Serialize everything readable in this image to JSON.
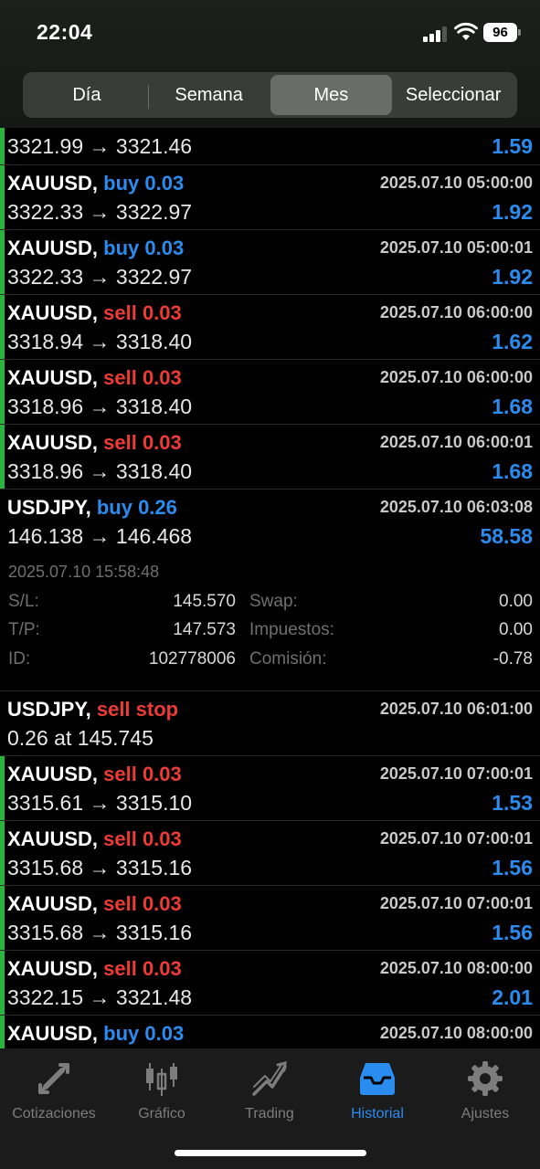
{
  "status": {
    "time": "22:04",
    "battery": "96"
  },
  "segments": [
    "Día",
    "Semana",
    "Mes",
    "Seleccionar"
  ],
  "active_segment": "Mes",
  "first_row": {
    "prices": "3321.99 → 3321.46",
    "profit": "1.59"
  },
  "rows": [
    {
      "symbol": "XAUUSD,",
      "side": "buy 0.03",
      "type": "buy",
      "time": "2025.07.10 05:00:00",
      "prices": "3322.33 → 3322.97",
      "profit": "1.92"
    },
    {
      "symbol": "XAUUSD,",
      "side": "buy 0.03",
      "type": "buy",
      "time": "2025.07.10 05:00:01",
      "prices": "3322.33 → 3322.97",
      "profit": "1.92"
    },
    {
      "symbol": "XAUUSD,",
      "side": "sell 0.03",
      "type": "sell",
      "time": "2025.07.10 06:00:00",
      "prices": "3318.94 → 3318.40",
      "profit": "1.62"
    },
    {
      "symbol": "XAUUSD,",
      "side": "sell 0.03",
      "type": "sell",
      "time": "2025.07.10 06:00:00",
      "prices": "3318.96 → 3318.40",
      "profit": "1.68"
    },
    {
      "symbol": "XAUUSD,",
      "side": "sell 0.03",
      "type": "sell",
      "time": "2025.07.10 06:00:01",
      "prices": "3318.96 → 3318.40",
      "profit": "1.68"
    }
  ],
  "expanded": {
    "symbol": "USDJPY,",
    "side": "buy 0.26",
    "time": "2025.07.10 06:03:08",
    "prices": "146.138 → 146.468",
    "profit": "58.58",
    "close_time": "2025.07.10 15:58:48",
    "sl_label": "S/L:",
    "sl_value": "145.570",
    "tp_label": "T/P:",
    "tp_value": "147.573",
    "id_label": "ID:",
    "id_value": "102778006",
    "swap_label": "Swap:",
    "swap_value": "0.00",
    "tax_label": "Impuestos:",
    "tax_value": "0.00",
    "commission_label": "Comisión:",
    "commission_value": "-0.78"
  },
  "pending": {
    "symbol": "USDJPY,",
    "side": "sell stop",
    "time": "2025.07.10 06:01:00",
    "prices": "0.26 at 145.745"
  },
  "rows2": [
    {
      "symbol": "XAUUSD,",
      "side": "sell 0.03",
      "type": "sell",
      "time": "2025.07.10 07:00:01",
      "prices": "3315.61 → 3315.10",
      "profit": "1.53"
    },
    {
      "symbol": "XAUUSD,",
      "side": "sell 0.03",
      "type": "sell",
      "time": "2025.07.10 07:00:01",
      "prices": "3315.68 → 3315.16",
      "profit": "1.56"
    },
    {
      "symbol": "XAUUSD,",
      "side": "sell 0.03",
      "type": "sell",
      "time": "2025.07.10 07:00:01",
      "prices": "3315.68 → 3315.16",
      "profit": "1.56"
    },
    {
      "symbol": "XAUUSD,",
      "side": "sell 0.03",
      "type": "sell",
      "time": "2025.07.10 08:00:00",
      "prices": "3322.15 → 3321.48",
      "profit": "2.01"
    },
    {
      "symbol": "XAUUSD,",
      "side": "buy 0.03",
      "type": "buy",
      "time": "2025.07.10 08:00:00",
      "prices": "",
      "profit": ""
    }
  ],
  "tabs": [
    {
      "label": "Cotizaciones",
      "icon": "quotes-arrows-icon"
    },
    {
      "label": "Gráfico",
      "icon": "candlestick-chart-icon"
    },
    {
      "label": "Trading",
      "icon": "trading-trend-icon"
    },
    {
      "label": "Historial",
      "icon": "history-inbox-icon"
    },
    {
      "label": "Ajustes",
      "icon": "gear-icon"
    }
  ],
  "active_tab": "Historial",
  "colors": {
    "buy": "#2b8cf0",
    "sell": "#ee3b36",
    "profit_bar": "#29b53b",
    "accent": "#2b8cf0"
  }
}
